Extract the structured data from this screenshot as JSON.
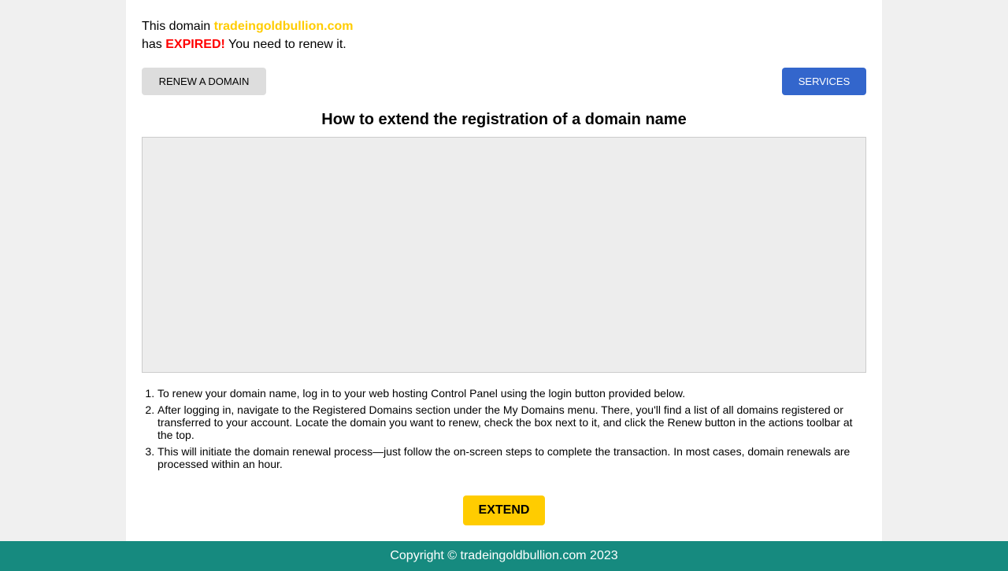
{
  "notice": {
    "line1_prefix": "This domain ",
    "domain": "tradeingoldbullion.com",
    "line2_prefix": "has ",
    "expired": "EXPIRED!",
    "line2_suffix": " You need to renew it."
  },
  "buttons": {
    "renew": "RENEW A DOMAIN",
    "services": "SERVICES",
    "extend": "EXTEND"
  },
  "heading": "How to extend the registration of a domain name",
  "steps": [
    "To renew your domain name, log in to your web hosting Control Panel using the login button provided below.",
    "After logging in, navigate to the Registered Domains section under the My Domains menu. There, you'll find a list of all domains registered or transferred to your account. Locate the domain you want to renew, check the box next to it, and click the Renew button in the actions toolbar at the top.",
    "This will initiate the domain renewal process—just follow the on-screen steps to complete the transaction. In most cases, domain renewals are processed within an hour."
  ],
  "footer": "Copyright © tradeingoldbullion.com 2023",
  "colors": {
    "domain": "#ffcc00",
    "expired": "#ff0000",
    "services_button": "#3366cc",
    "extend_button": "#ffcc00",
    "footer": "#168a7f"
  }
}
